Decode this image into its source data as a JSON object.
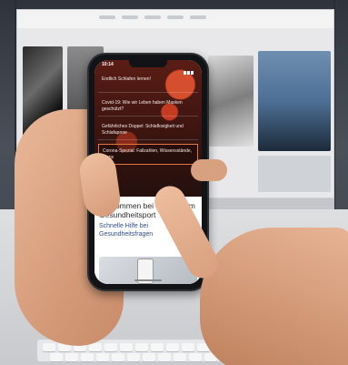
{
  "status_bar": {
    "time": "10:14"
  },
  "hero_menu": {
    "items": [
      {
        "label": "Endlich Schlafen lernen!"
      },
      {
        "label": "Covid-19: Wie wir Leben haben Masken geschützt?"
      },
      {
        "label": "Gefährliches Doppel: Schlaflosigkeit und Schlafapnoe"
      },
      {
        "label": "Corona-Spezial: Fallzahlen, Wissensstände, Tipps"
      }
    ]
  },
  "content": {
    "welcome": "Willkommen bei NetD Ihrem Gesundheitsport",
    "help": "Schnelle Hilfe bei Gesundheitsfragen"
  },
  "fab_icon": "plus-icon",
  "colors": {
    "hero_dark": "#3b1410",
    "accent_orange": "#e07a45",
    "link_blue": "#2f4f8a",
    "fab_blue": "#2a8fd6"
  }
}
